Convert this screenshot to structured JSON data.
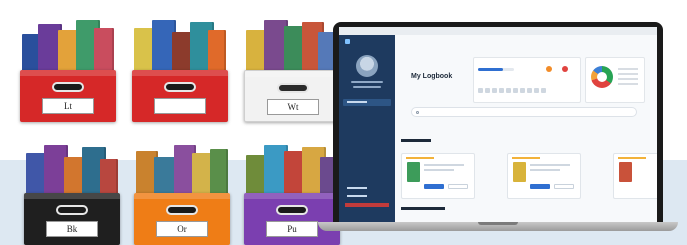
{
  "bins": [
    {
      "label": "Lt"
    },
    {
      "label": ""
    },
    {
      "label": "Wt"
    },
    {
      "label": "Bk"
    },
    {
      "label": "Or"
    },
    {
      "label": "Pu"
    }
  ],
  "laptop": {
    "heading": "My Logbook",
    "reading_progress": 0.7
  },
  "colors": {
    "bin_red": "#d62828",
    "bin_black": "#1f1f1f",
    "bin_orange": "#ef7d16",
    "bin_purple": "#7b3fb0",
    "bin_white": "#f2f2f2",
    "sidebar": "#1e3a5f",
    "backdrop": "#dde8f2"
  }
}
